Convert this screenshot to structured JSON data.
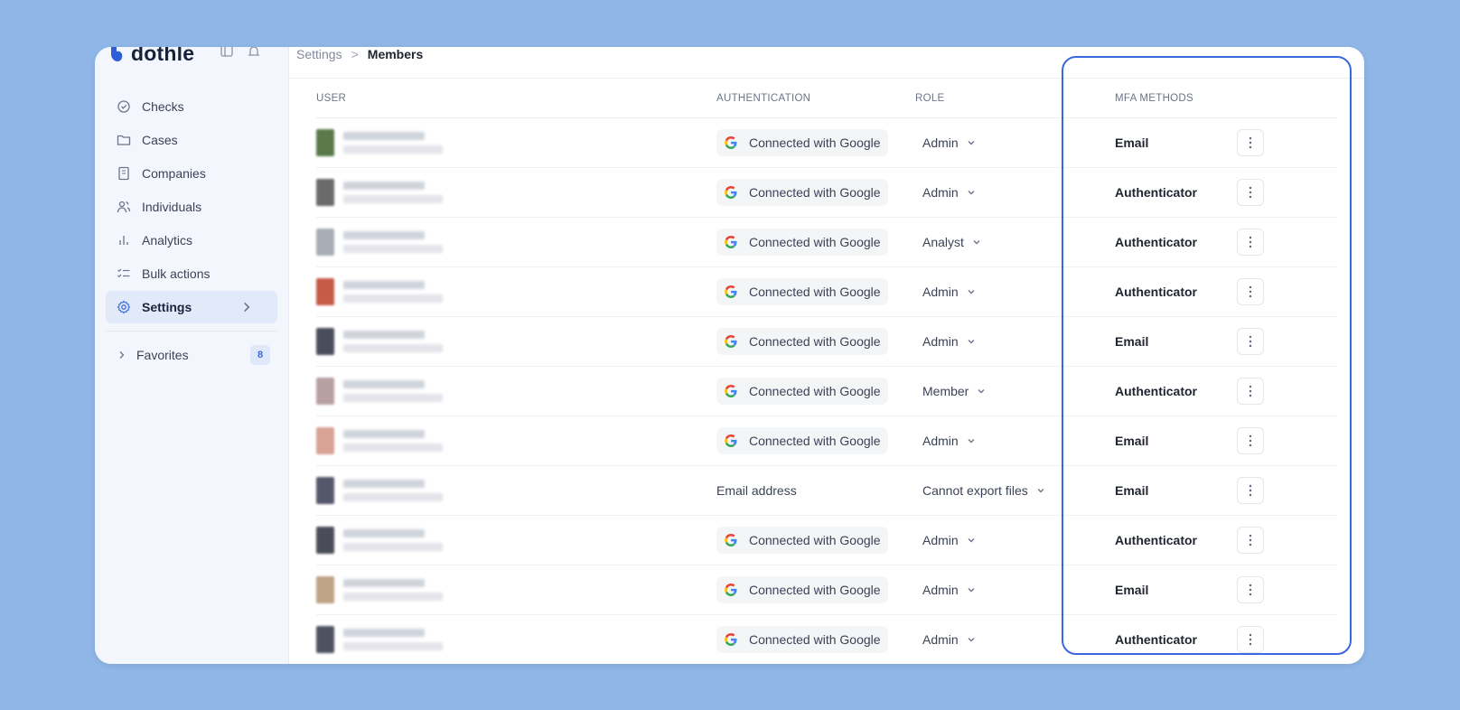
{
  "brand": {
    "name": "dothle",
    "logo_color": "#2f5fd6"
  },
  "sidebar": {
    "items": [
      {
        "label": "Checks",
        "icon": "check-circle-icon"
      },
      {
        "label": "Cases",
        "icon": "folder-icon"
      },
      {
        "label": "Companies",
        "icon": "building-icon"
      },
      {
        "label": "Individuals",
        "icon": "users-icon"
      },
      {
        "label": "Analytics",
        "icon": "bar-chart-icon"
      },
      {
        "label": "Bulk actions",
        "icon": "checklist-icon"
      },
      {
        "label": "Settings",
        "icon": "gear-icon",
        "active": true
      }
    ],
    "favorites_label": "Favorites",
    "favorites_count": "8"
  },
  "breadcrumb": {
    "parent": "Settings",
    "separator": ">",
    "current": "Members"
  },
  "table": {
    "headers": {
      "user": "USER",
      "auth": "AUTHENTICATION",
      "role": "ROLE",
      "mfa": "MFA METHODS"
    },
    "rows": [
      {
        "auth": "Connected with Google",
        "google": true,
        "role": "Admin",
        "mfa": "Email",
        "avatar": "#5a7a4a"
      },
      {
        "auth": "Connected with Google",
        "google": true,
        "role": "Admin",
        "mfa": "Authenticator",
        "avatar": "#6a6a6a"
      },
      {
        "auth": "Connected with Google",
        "google": true,
        "role": "Analyst",
        "mfa": "Authenticator",
        "avatar": "#a8aeb6"
      },
      {
        "auth": "Connected with Google",
        "google": true,
        "role": "Admin",
        "mfa": "Authenticator",
        "avatar": "#c85a48"
      },
      {
        "auth": "Connected with Google",
        "google": true,
        "role": "Admin",
        "mfa": "Email",
        "avatar": "#4a4e5c"
      },
      {
        "auth": "Connected with Google",
        "google": true,
        "role": "Member",
        "mfa": "Authenticator",
        "avatar": "#b8a0a2"
      },
      {
        "auth": "Connected with Google",
        "google": true,
        "role": "Admin",
        "mfa": "Email",
        "avatar": "#d8a294"
      },
      {
        "auth": "Email address",
        "google": false,
        "role": "Cannot export files",
        "mfa": "Email",
        "avatar": "#55586a"
      },
      {
        "auth": "Connected with Google",
        "google": true,
        "role": "Admin",
        "mfa": "Authenticator",
        "avatar": "#4a4c58"
      },
      {
        "auth": "Connected with Google",
        "google": true,
        "role": "Admin",
        "mfa": "Email",
        "avatar": "#c0a286"
      },
      {
        "auth": "Connected with Google",
        "google": true,
        "role": "Admin",
        "mfa": "Authenticator",
        "avatar": "#4e5260"
      }
    ]
  },
  "colors": {
    "background": "#8fb6e6",
    "highlight": "#3a68e0",
    "accent": "#3d68d8"
  }
}
